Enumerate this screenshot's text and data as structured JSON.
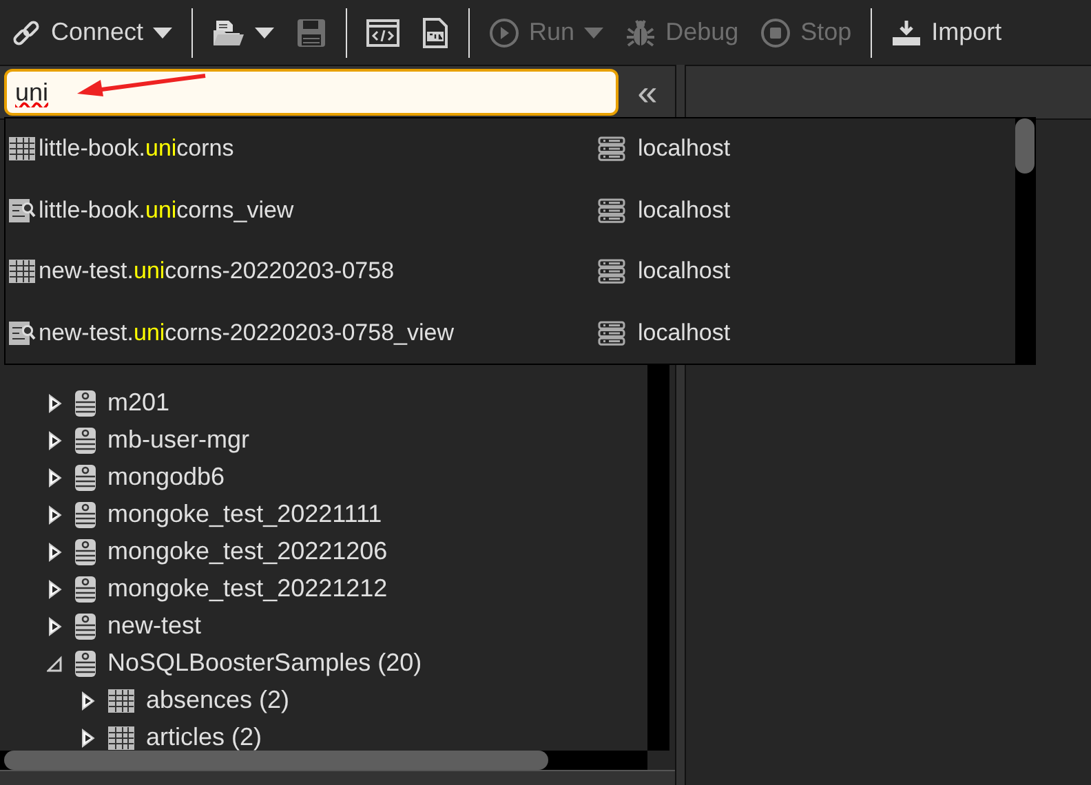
{
  "toolbar": {
    "items": [
      {
        "kind": "button",
        "label": "Connect",
        "caret": true,
        "disabled": false
      },
      {
        "kind": "separator"
      },
      {
        "kind": "icon",
        "caret": true,
        "disabled": false
      },
      {
        "kind": "icon",
        "caret": false,
        "disabled": true
      },
      {
        "kind": "separator"
      },
      {
        "kind": "icon",
        "caret": false,
        "disabled": false
      },
      {
        "kind": "icon",
        "caret": false,
        "disabled": false
      },
      {
        "kind": "separator"
      },
      {
        "kind": "button",
        "label": "Run",
        "caret": true,
        "disabled": true
      },
      {
        "kind": "button",
        "label": "Debug",
        "caret": false,
        "disabled": true
      },
      {
        "kind": "button",
        "label": "Stop",
        "caret": false,
        "disabled": true
      },
      {
        "kind": "separator"
      },
      {
        "kind": "button",
        "label": "Import",
        "caret": false,
        "disabled": false
      }
    ]
  },
  "search": {
    "value": "uni",
    "collapse_label": "«"
  },
  "results": [
    {
      "kind": "collection",
      "prefix": "little-book.",
      "match": "uni",
      "suffix": "corns",
      "server": "localhost"
    },
    {
      "kind": "view",
      "prefix": "little-book.",
      "match": "uni",
      "suffix": "corns_view",
      "server": "localhost"
    },
    {
      "kind": "collection",
      "prefix": "new-test.",
      "match": "uni",
      "suffix": "corns-20220203-0758",
      "server": "localhost"
    },
    {
      "kind": "view",
      "prefix": "new-test.",
      "match": "uni",
      "suffix": "corns-20220203-0758_view",
      "server": "localhost"
    }
  ],
  "tree": [
    {
      "kind": "database",
      "label": "m201",
      "expanded": false
    },
    {
      "kind": "database",
      "label": "mb-user-mgr",
      "expanded": false
    },
    {
      "kind": "database",
      "label": "mongodb6",
      "expanded": false
    },
    {
      "kind": "database",
      "label": "mongoke_test_20221111",
      "expanded": false
    },
    {
      "kind": "database",
      "label": "mongoke_test_20221206",
      "expanded": false
    },
    {
      "kind": "database",
      "label": "mongoke_test_20221212",
      "expanded": false
    },
    {
      "kind": "database",
      "label": "new-test",
      "expanded": false
    },
    {
      "kind": "database",
      "label": "NoSQLBoosterSamples (20)",
      "expanded": true,
      "children": [
        {
          "kind": "collection",
          "label": "absences (2)",
          "expanded": false
        },
        {
          "kind": "collection",
          "label": "articles (2)",
          "expanded": false
        }
      ]
    }
  ]
}
